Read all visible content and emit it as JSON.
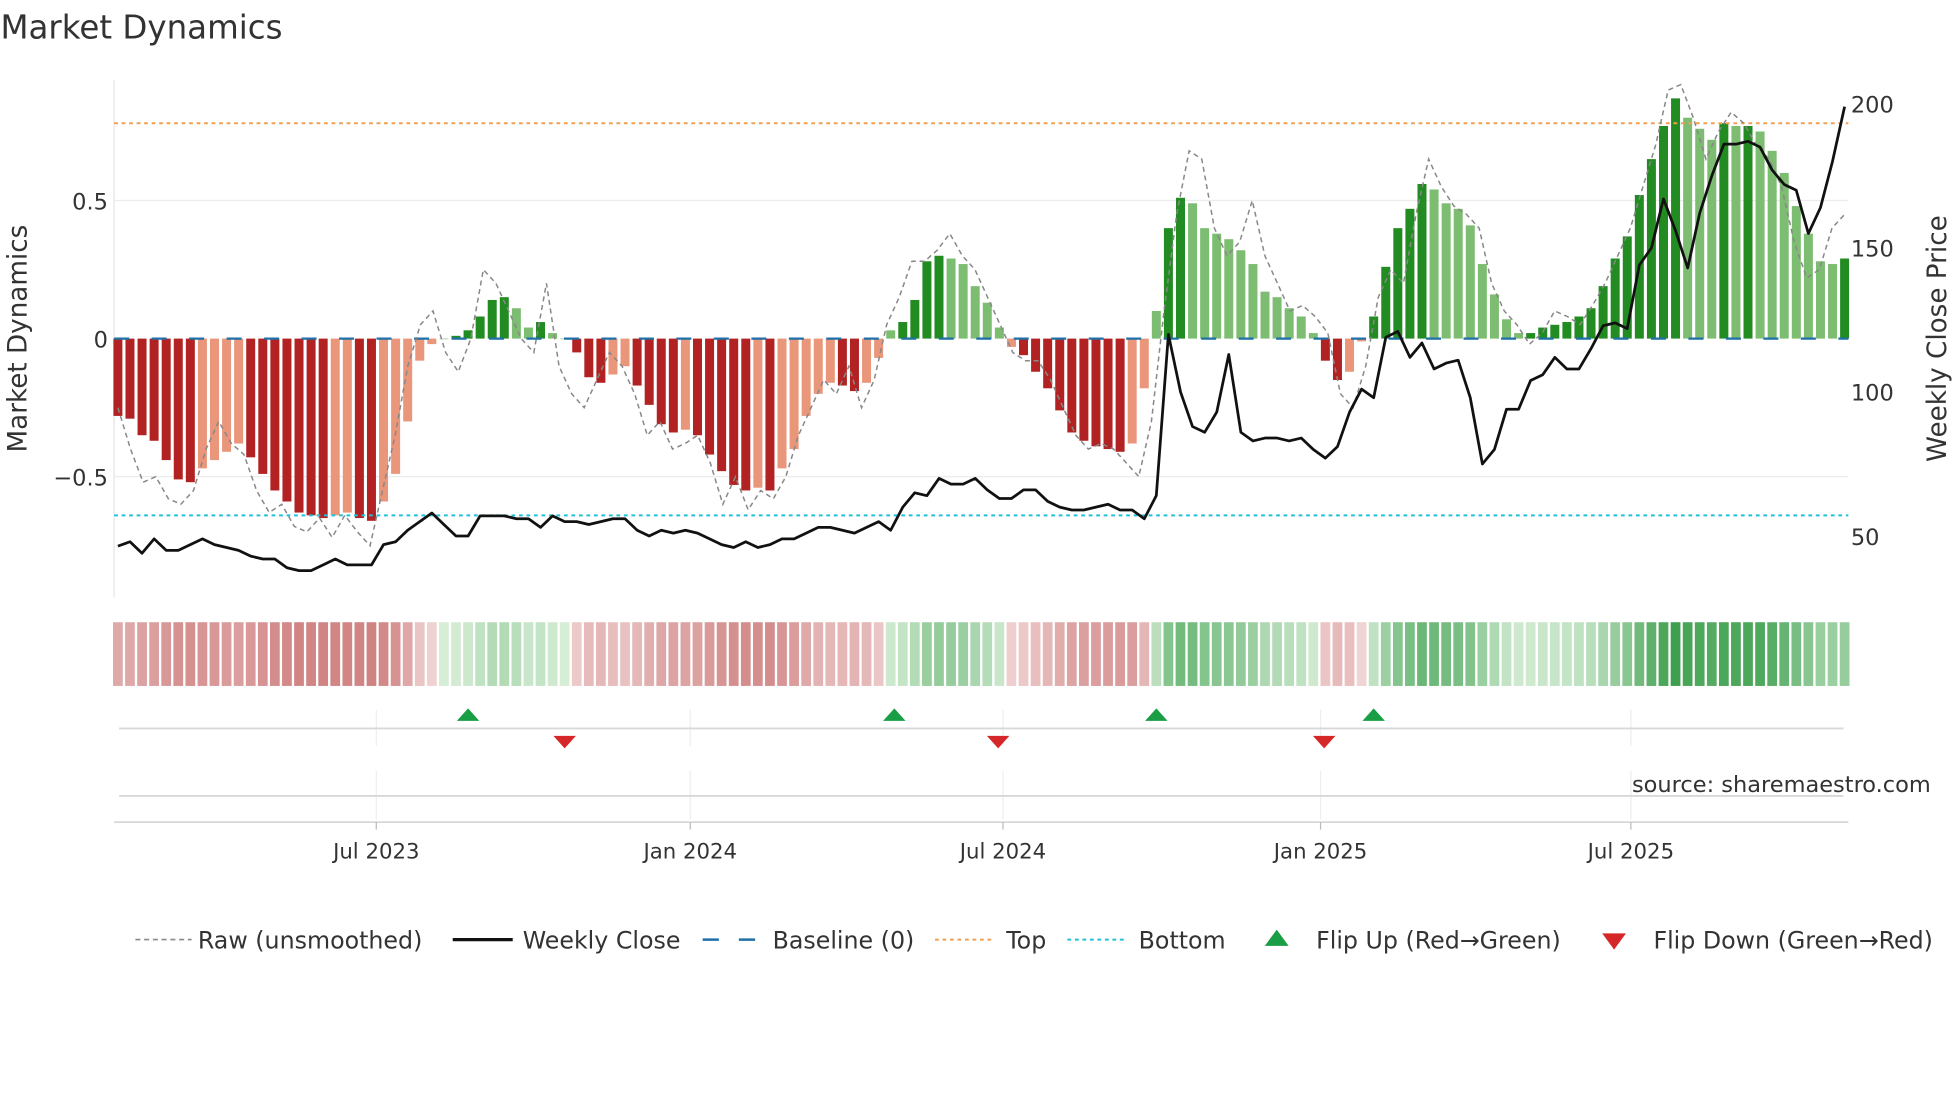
{
  "title": "Market Dynamics",
  "source": "source: sharemaestro.com",
  "colors": {
    "green_dark": "#228b22",
    "green_light": "#7dbd72",
    "red_dark": "#b22222",
    "red_light": "#e9967a",
    "raw": "#888888",
    "close": "#111111",
    "baseline": "#1f6fa8",
    "top": "#f0a050",
    "bottom": "#20c0d8",
    "flip_up": "#1a9e45",
    "flip_down": "#d62728"
  },
  "chart_data": {
    "type": "bar",
    "title": "Market Dynamics",
    "ylabel": "Market Dynamics",
    "y2label": "Weekly Close Price",
    "ylim": [
      -0.95,
      0.93
    ],
    "y2lim": [
      28,
      210
    ],
    "yticks": [
      {
        "v": 0.5,
        "label": "0.5"
      },
      {
        "v": 0,
        "label": "0"
      },
      {
        "v": -0.5,
        "label": "−0.5"
      }
    ],
    "y2ticks": [
      {
        "v": 200,
        "label": "200"
      },
      {
        "v": 150,
        "label": "150"
      },
      {
        "v": 100,
        "label": "100"
      },
      {
        "v": 50,
        "label": "50"
      }
    ],
    "xticks": [
      {
        "week": 21.4,
        "label": "Jul 2023"
      },
      {
        "week": 47.4,
        "label": "Jan 2024"
      },
      {
        "week": 73.3,
        "label": "Jul 2024"
      },
      {
        "week": 99.6,
        "label": "Jan 2025"
      },
      {
        "week": 125.3,
        "label": "Jul 2025"
      }
    ],
    "top": 0.78,
    "bottom": -0.64,
    "baseline": 0,
    "smoothed": [
      -0.28,
      -0.29,
      -0.35,
      -0.37,
      -0.44,
      -0.51,
      -0.52,
      -0.47,
      -0.44,
      -0.41,
      -0.38,
      -0.43,
      -0.49,
      -0.55,
      -0.59,
      -0.63,
      -0.64,
      -0.65,
      -0.64,
      -0.63,
      -0.65,
      -0.66,
      -0.59,
      -0.49,
      -0.3,
      -0.08,
      -0.02,
      0.0,
      0.01,
      0.03,
      0.08,
      0.14,
      0.15,
      0.11,
      0.04,
      0.06,
      0.02,
      0.0,
      -0.05,
      -0.14,
      -0.16,
      -0.13,
      -0.1,
      -0.17,
      -0.24,
      -0.31,
      -0.34,
      -0.33,
      -0.35,
      -0.42,
      -0.48,
      -0.53,
      -0.55,
      -0.54,
      -0.55,
      -0.47,
      -0.4,
      -0.28,
      -0.2,
      -0.16,
      -0.17,
      -0.19,
      -0.16,
      -0.07,
      0.03,
      0.06,
      0.14,
      0.28,
      0.3,
      0.29,
      0.27,
      0.19,
      0.13,
      0.04,
      -0.03,
      -0.06,
      -0.12,
      -0.18,
      -0.26,
      -0.34,
      -0.37,
      -0.39,
      -0.4,
      -0.41,
      -0.38,
      -0.18,
      0.1,
      0.4,
      0.51,
      0.49,
      0.4,
      0.38,
      0.36,
      0.32,
      0.27,
      0.17,
      0.15,
      0.11,
      0.08,
      0.02,
      -0.08,
      -0.15,
      -0.12,
      -0.01,
      0.08,
      0.26,
      0.4,
      0.47,
      0.56,
      0.54,
      0.49,
      0.47,
      0.41,
      0.27,
      0.16,
      0.07,
      0.02,
      0.02,
      0.04,
      0.05,
      0.06,
      0.08,
      0.11,
      0.19,
      0.29,
      0.37,
      0.52,
      0.65,
      0.77,
      0.87,
      0.8,
      0.76,
      0.72,
      0.78,
      0.77,
      0.77,
      0.75,
      0.68,
      0.6,
      0.48,
      0.38,
      0.28,
      0.27,
      0.29
    ],
    "raw": [
      -0.25,
      -0.4,
      -0.52,
      -0.5,
      -0.58,
      -0.6,
      -0.55,
      -0.4,
      -0.3,
      -0.38,
      -0.42,
      -0.55,
      -0.63,
      -0.6,
      -0.68,
      -0.7,
      -0.65,
      -0.72,
      -0.64,
      -0.7,
      -0.75,
      -0.55,
      -0.35,
      -0.1,
      0.05,
      0.1,
      -0.05,
      -0.12,
      0.0,
      0.25,
      0.2,
      0.1,
      0.0,
      -0.05,
      0.2,
      -0.1,
      -0.2,
      -0.25,
      -0.15,
      -0.05,
      -0.1,
      -0.2,
      -0.35,
      -0.3,
      -0.4,
      -0.38,
      -0.35,
      -0.45,
      -0.6,
      -0.5,
      -0.62,
      -0.55,
      -0.58,
      -0.5,
      -0.35,
      -0.25,
      -0.15,
      -0.2,
      -0.1,
      -0.25,
      -0.15,
      0.05,
      0.15,
      0.28,
      0.28,
      0.32,
      0.38,
      0.3,
      0.25,
      0.15,
      0.05,
      -0.05,
      -0.08,
      -0.08,
      -0.15,
      -0.25,
      -0.35,
      -0.4,
      -0.38,
      -0.4,
      -0.45,
      -0.5,
      -0.3,
      0.1,
      0.45,
      0.68,
      0.65,
      0.4,
      0.3,
      0.35,
      0.5,
      0.3,
      0.2,
      0.1,
      0.12,
      0.08,
      0.02,
      -0.2,
      -0.25,
      -0.1,
      0.15,
      0.25,
      0.2,
      0.45,
      0.65,
      0.55,
      0.48,
      0.45,
      0.4,
      0.2,
      0.1,
      0.05,
      -0.02,
      0.02,
      0.1,
      0.08,
      0.05,
      0.12,
      0.2,
      0.3,
      0.4,
      0.55,
      0.7,
      0.9,
      0.92,
      0.8,
      0.65,
      0.75,
      0.82,
      0.78,
      0.7,
      0.65,
      0.55,
      0.35,
      0.22,
      0.25,
      0.4,
      0.45
    ],
    "close": [
      46.5,
      48,
      44,
      49,
      45,
      45,
      47,
      49,
      47,
      46,
      45,
      43,
      42,
      42,
      39,
      38,
      38,
      40,
      42,
      40,
      40,
      40,
      47,
      48,
      52,
      55,
      58,
      54,
      50,
      50,
      57,
      57,
      57,
      56,
      56,
      53,
      57,
      55,
      55,
      54,
      55,
      56,
      56,
      52,
      50,
      52,
      51,
      52,
      51,
      49,
      47,
      46,
      48,
      46,
      47,
      49,
      49,
      51,
      53,
      53,
      52,
      51,
      53,
      55,
      52,
      60,
      65,
      64,
      70,
      68,
      68,
      70,
      66,
      63,
      63,
      66,
      66,
      62,
      60,
      59,
      59,
      60,
      61,
      59,
      59,
      56,
      64,
      120,
      100,
      88,
      86,
      93,
      113,
      86,
      83,
      84,
      84,
      83,
      84,
      80,
      77,
      81,
      93,
      101,
      98,
      119,
      121,
      112,
      117,
      108,
      110,
      111,
      98,
      75,
      80,
      94,
      94,
      104,
      106,
      112,
      108,
      108,
      115,
      123,
      124,
      122,
      144,
      150,
      167,
      156,
      143,
      162,
      175,
      186,
      186,
      187,
      185,
      177,
      172,
      170,
      155,
      164,
      180,
      199
    ],
    "flip_up_weeks": [
      29,
      64.3,
      86,
      104
    ],
    "flip_down_weeks": [
      37,
      72.9,
      99.9
    ],
    "legend": {
      "placement": "bottom",
      "items": [
        {
          "key": "raw",
          "label": "Raw (unsmoothed)"
        },
        {
          "key": "close",
          "label": "Weekly Close"
        },
        {
          "key": "baseline",
          "label": "Baseline (0)"
        },
        {
          "key": "top",
          "label": "Top"
        },
        {
          "key": "bottom",
          "label": "Bottom"
        },
        {
          "key": "flip_up",
          "label": "Flip Up (Red→Green)"
        },
        {
          "key": "flip_down",
          "label": "Flip Down (Green→Red)"
        }
      ]
    }
  }
}
